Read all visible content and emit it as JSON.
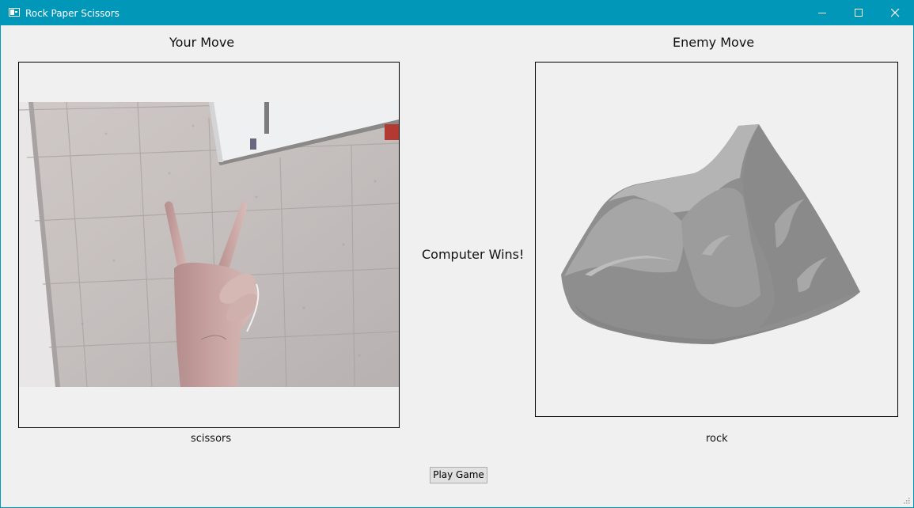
{
  "window": {
    "title": "Rock Paper Scissors",
    "accent_color": "#0097b9",
    "controls": [
      "minimize-icon",
      "maximize-icon",
      "close-icon"
    ]
  },
  "player": {
    "heading": "Your Move",
    "move": "scissors",
    "image": "webcam-photo-hand-v-sign"
  },
  "enemy": {
    "heading": "Enemy Move",
    "move": "rock",
    "image": "rock-illustration"
  },
  "result": {
    "text": "Computer Wins!"
  },
  "actions": {
    "play_button_label": "Play Game"
  }
}
